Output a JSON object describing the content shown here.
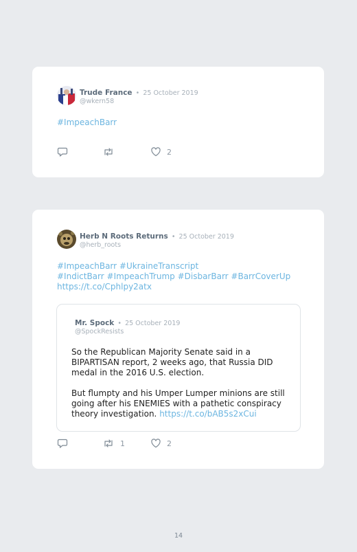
{
  "tweet1": {
    "name": "Trude France",
    "separator": "•",
    "date": "25 October 2019",
    "handle": "@wkern58",
    "hashtag": "#ImpeachBarr",
    "likes": "2"
  },
  "tweet2": {
    "name": "Herb N Roots Returns",
    "separator": "•",
    "date": "25 October 2019",
    "handle": "@herb_roots",
    "line1": "#ImpeachBarr #UkraineTranscript",
    "line2": "#IndictBarr #ImpeachTrump #DisbarBarr #BarrCoverUp",
    "line3": "https://t.co/Cphlpy2atx",
    "retweets": "1",
    "likes": "2",
    "quote": {
      "name": "Mr. Spock",
      "separator": "•",
      "date": "25 October 2019",
      "handle": "@SpockResists",
      "para1": "So the Republican Majority Senate said in a BIPARTISAN report, 2 weeks ago, that Russia DID medal in the 2016 U.S. election.",
      "para2": "But flumpty and his Umper Lumper minions are still going after his ENEMIES with a pathetic conspiracy theory investigation.",
      "para2_link": "https://t.co/bAB5s2xCui"
    }
  },
  "page_number": "14",
  "icons": {
    "reply": "reply-icon",
    "retweet": "retweet-icon",
    "like": "heart-icon"
  },
  "colors": {
    "link": "#6cb5e0",
    "name": "#5c6b7a",
    "meta": "#a7b0b9",
    "background": "#e9ebee",
    "card": "#ffffff"
  }
}
